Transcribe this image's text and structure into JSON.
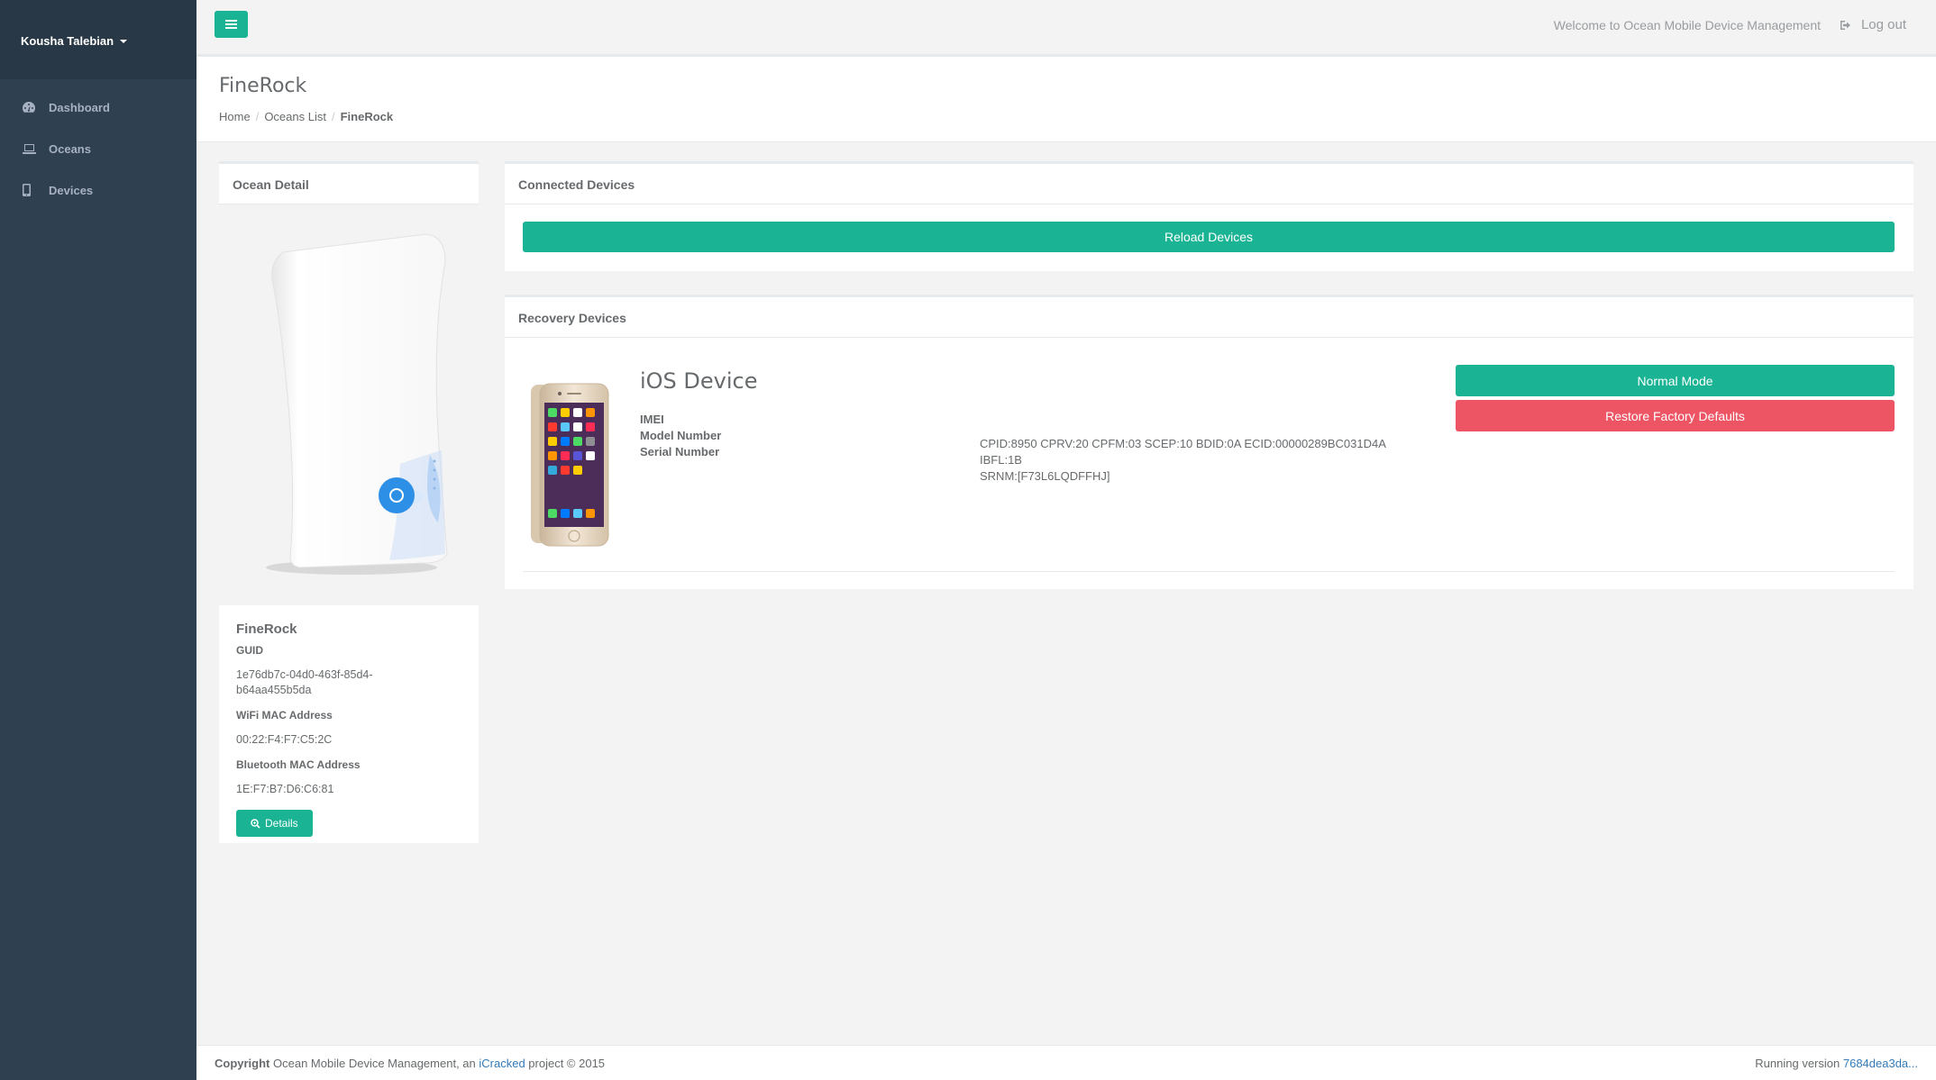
{
  "sidebar": {
    "user_name": "Kousha Talebian",
    "items": [
      {
        "label": "Dashboard",
        "icon": "dashboard-icon"
      },
      {
        "label": "Oceans",
        "icon": "laptop-icon"
      },
      {
        "label": "Devices",
        "icon": "mobile-icon"
      }
    ]
  },
  "topbar": {
    "welcome": "Welcome to Ocean Mobile Device Management",
    "logout": "Log out"
  },
  "heading": {
    "title": "FineRock",
    "breadcrumb": [
      "Home",
      "Oceans List",
      "FineRock"
    ]
  },
  "ocean_detail": {
    "title": "Ocean Detail",
    "name": "FineRock",
    "guid_label": "GUID",
    "guid_line1": "1e76db7c-04d0-463f-85d4-",
    "guid_line2": "b64aa455b5da",
    "wifi_label": "WiFi MAC Address",
    "wifi_value": "00:22:F4:F7:C5:2C",
    "bt_label": "Bluetooth MAC Address",
    "bt_value": "1E:F7:B7:D6:C6:81",
    "details_button": "Details"
  },
  "connected": {
    "title": "Connected Devices",
    "reload_button": "Reload Devices"
  },
  "recovery": {
    "title": "Recovery Devices",
    "device_title": "iOS Device",
    "imei_label": "IMEI",
    "model_label": "Model Number",
    "serial_label": "Serial Number",
    "serial_line1": "CPID:8950 CPRV:20 CPFM:03 SCEP:10 BDID:0A ECID:00000289BC031D4A IBFL:1B",
    "serial_line2": "SRNM:[F73L6LQDFFHJ]",
    "normal_button": "Normal Mode",
    "restore_button": "Restore Factory Defaults"
  },
  "footer": {
    "copyright_label": "Copyright",
    "text_before": "Ocean Mobile Device Management, an",
    "link": "iCracked",
    "text_after": "project © 2015",
    "version_label": "Running version",
    "version_link": "7684dea3da..."
  },
  "colors": {
    "primary": "#1ab394",
    "danger": "#ed5565",
    "sidebar": "#2f4050"
  }
}
